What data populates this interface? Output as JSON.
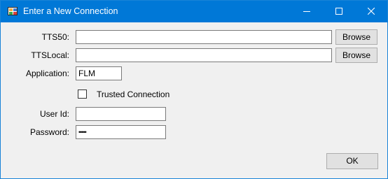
{
  "window": {
    "title": "Enter a New Connection",
    "icon": "windows-forms-app-icon",
    "accent_color": "#0078d7"
  },
  "form": {
    "tts50": {
      "label": "TTS50:",
      "value": "",
      "browse_label": "Browse"
    },
    "ttslocal": {
      "label": "TTSLocal:",
      "value": "",
      "browse_label": "Browse"
    },
    "application": {
      "label": "Application:",
      "value": "FLM"
    },
    "trusted_connection": {
      "label": "Trusted Connection",
      "checked": false
    },
    "user_id": {
      "label": "User Id:",
      "value": ""
    },
    "password": {
      "label": "Password:",
      "value": "•••••"
    },
    "ok_label": "OK"
  }
}
